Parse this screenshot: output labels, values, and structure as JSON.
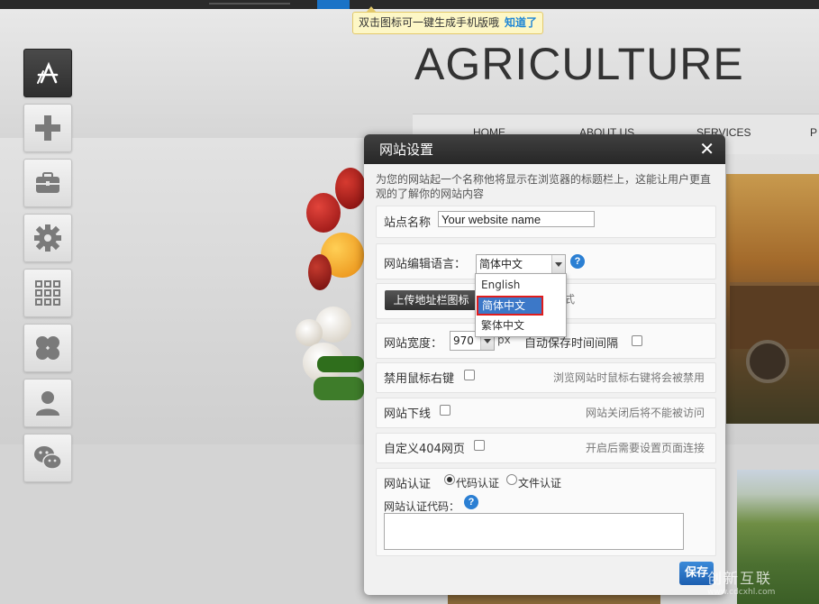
{
  "tooltip": {
    "text": "双击图标可一键生成手机版哦",
    "ok": "知道了"
  },
  "site": {
    "title": "AGRICULTURE",
    "nav": [
      "HOME",
      "ABOUT US",
      "SERVICES",
      "P"
    ]
  },
  "sidebar": {
    "icons": [
      "app-store-icon",
      "plus-icon",
      "briefcase-icon",
      "gear-icon",
      "grid-icon",
      "clover-icon",
      "user-icon",
      "wechat-icon"
    ]
  },
  "dialog": {
    "title": "网站设置",
    "close": "✕",
    "description": "为您的网站起一个名称他将显示在浏览器的标题栏上，这能让用户更直观的了解你的网站内容",
    "site_name": {
      "label": "站点名称",
      "value": "Your website name"
    },
    "language": {
      "label": "网站编辑语言：",
      "selected": "简体中文",
      "help": "?",
      "options": [
        "English",
        "简体中文",
        "繁体中文"
      ]
    },
    "favicon": {
      "button": "上传地址栏图标",
      "hint_suffix": "式"
    },
    "width": {
      "label": "网站宽度：",
      "value": "970",
      "unit": "px",
      "autosave_label": "自动保存时间间隔"
    },
    "disable_right_click": {
      "label": "禁用鼠标右键",
      "hint": "浏览网站时鼠标右键将会被禁用"
    },
    "offline": {
      "label": "网站下线",
      "hint": "网站关闭后将不能被访问"
    },
    "custom_404": {
      "label": "自定义404网页",
      "hint": "开启后需要设置页面连接"
    },
    "verification": {
      "label": "网站认证",
      "option_code": "代码认证",
      "option_file": "文件认证",
      "code_label": "网站认证代码：",
      "help": "?"
    },
    "save": "保存"
  },
  "watermark": {
    "text": "创新互联",
    "sub": "www.cdcxhl.com"
  },
  "colors": {
    "accent": "#2b7fd3",
    "dialog_header": "#2e2e2e",
    "highlight": "#e01d1d"
  }
}
